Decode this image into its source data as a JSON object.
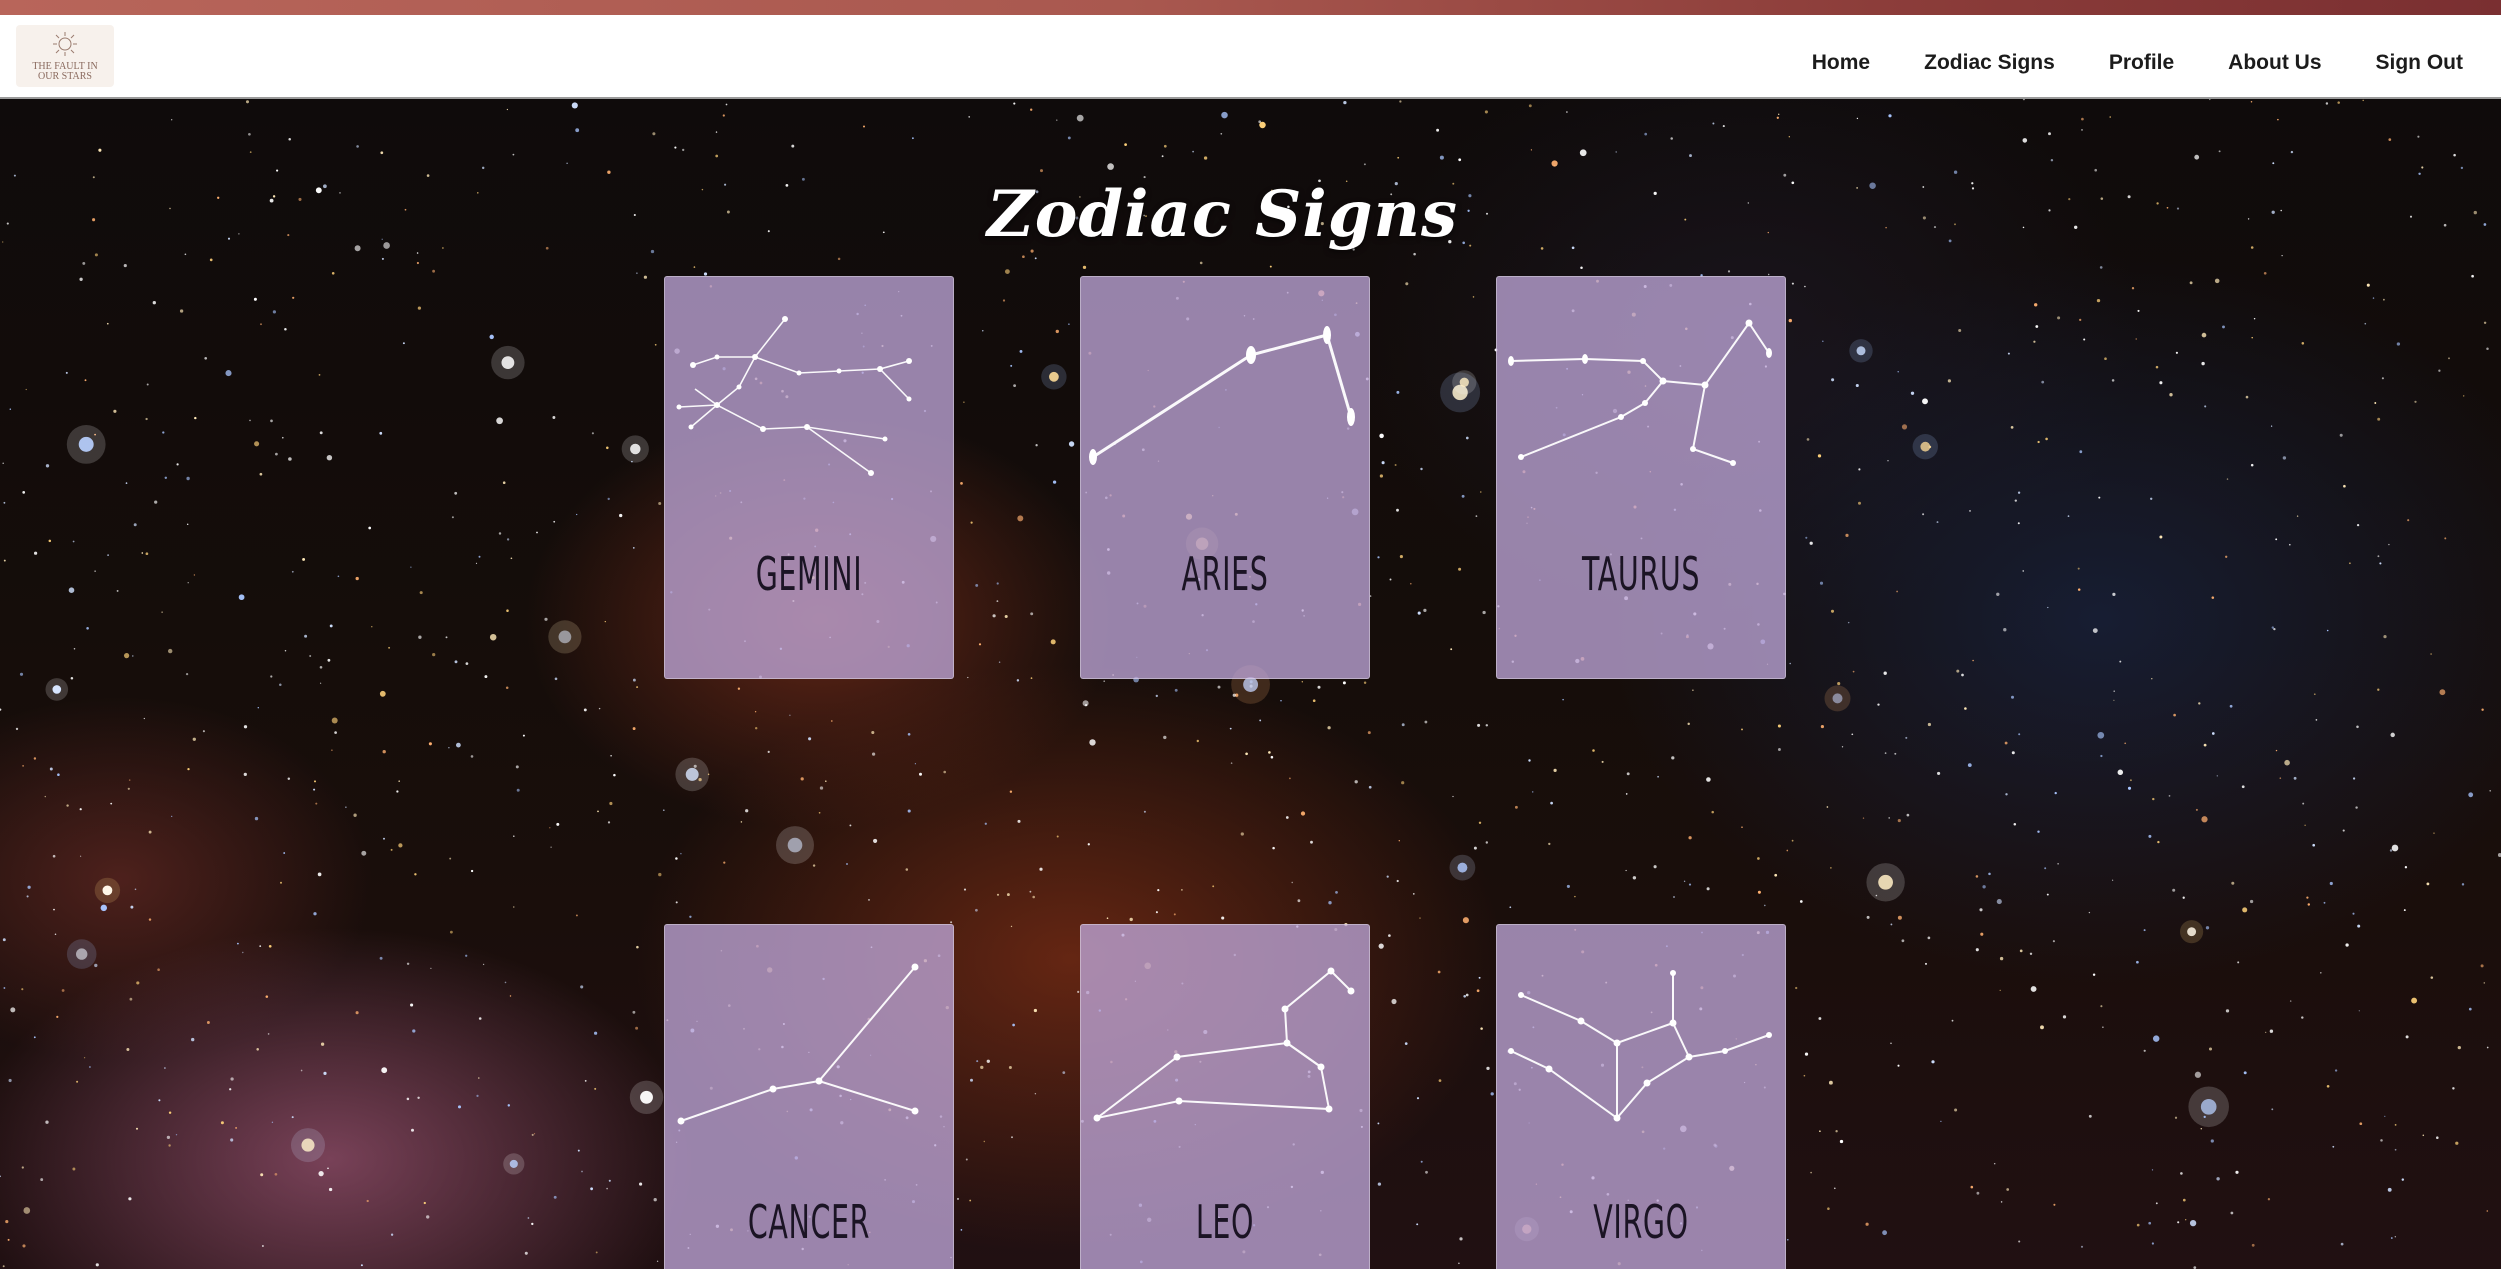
{
  "logo": {
    "text": "THE FAULT IN OUR STARS"
  },
  "nav": {
    "links": [
      "Home",
      "Zodiac Signs",
      "Profile",
      "About Us",
      "Sign Out"
    ]
  },
  "main": {
    "title": "Zodiac Signs"
  },
  "signs": [
    {
      "name": "GEMINI"
    },
    {
      "name": "ARIES"
    },
    {
      "name": "TAURUS"
    },
    {
      "name": "CANCER"
    },
    {
      "name": "LEO"
    },
    {
      "name": "VIRGO"
    }
  ],
  "colors": {
    "card_background": "#bea5d7",
    "nav_text": "#1c1c1c",
    "accent_bar": "#a9584f",
    "title_text": "#ffffff"
  }
}
